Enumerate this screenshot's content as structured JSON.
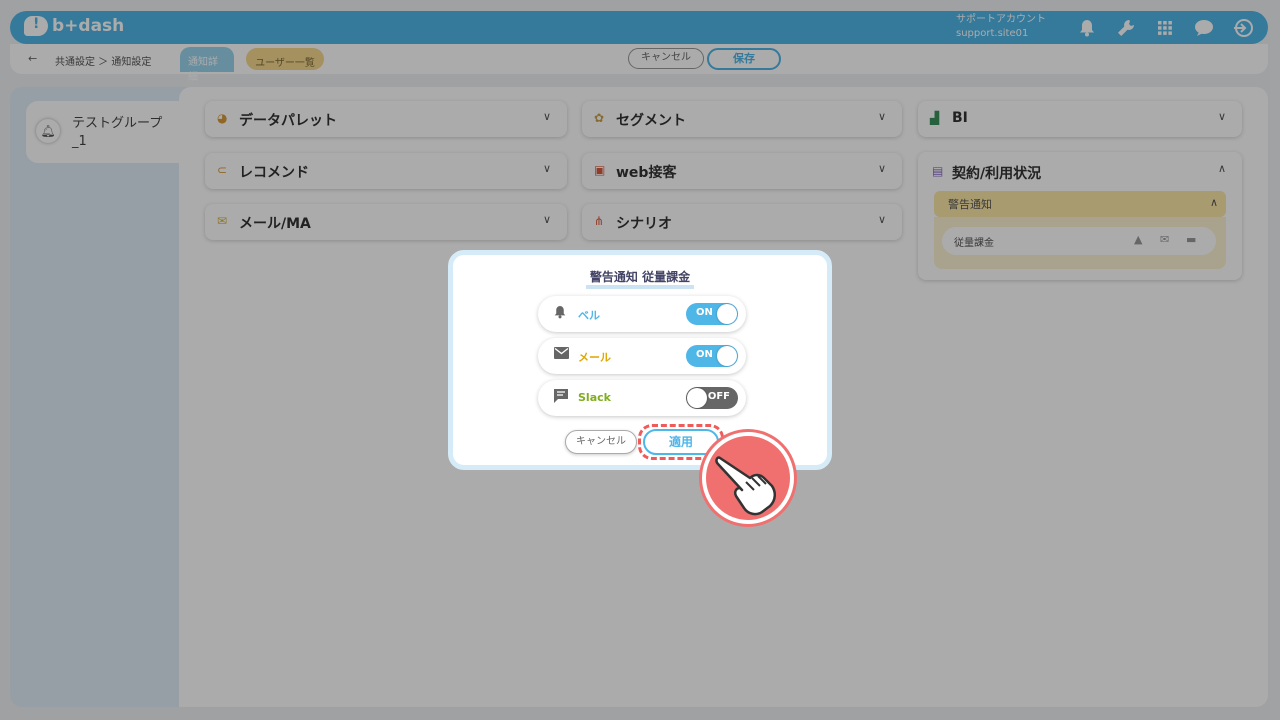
{
  "brand": "b+dash",
  "account": {
    "line1": "サポートアカウント",
    "line2": "support.site01"
  },
  "header_icons": [
    "bell-icon",
    "wrench-icon",
    "grid-icon",
    "chat-icon",
    "logout-icon"
  ],
  "breadcrumb": "共通設定 ＞ 通知設定",
  "tabs": [
    {
      "label": "通知詳細"
    },
    {
      "label": "ユーザー一覧"
    }
  ],
  "top_buttons": {
    "cancel": "キャンセル",
    "save": "保存"
  },
  "sidebar": {
    "group_name": "テストグループ_1"
  },
  "categories": [
    {
      "label": "データパレット",
      "icon": "palette-icon"
    },
    {
      "label": "セグメント",
      "icon": "segment-icon"
    },
    {
      "label": "BI",
      "icon": "bi-icon"
    },
    {
      "label": "レコメンド",
      "icon": "recommend-icon"
    },
    {
      "label": "web接客",
      "icon": "web-icon"
    },
    {
      "label": "メール/MA",
      "icon": "mail-icon"
    },
    {
      "label": "シナリオ",
      "icon": "scenario-icon"
    }
  ],
  "contract": {
    "label": "契約/利用状況",
    "warning": {
      "title": "警告通知",
      "item": "従量課金"
    }
  },
  "modal": {
    "title": "警告通知 従量課金",
    "rows": [
      {
        "label": "ベル",
        "state": "ON",
        "color": "#4fb6e8"
      },
      {
        "label": "メール",
        "state": "ON",
        "color": "#e0a800"
      },
      {
        "label": "Slack",
        "state": "OFF",
        "color": "#7fae1f"
      }
    ],
    "cancel": "キャンセル",
    "apply": "適用"
  },
  "colors": {
    "accent": "#4fb6e8",
    "highlight": "#f07070"
  }
}
